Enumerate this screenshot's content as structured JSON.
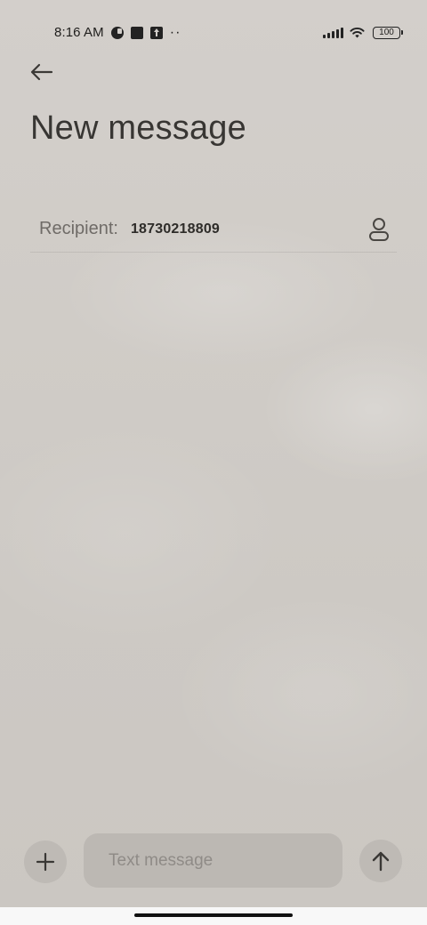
{
  "status_bar": {
    "time": "8:16 AM",
    "left_icons": [
      "circle-status-icon",
      "square-status-icon",
      "upload-status-icon"
    ],
    "more_indicator": "··",
    "battery_level": "100"
  },
  "header": {
    "back_icon": "arrow-left-icon",
    "title": "New message"
  },
  "recipient": {
    "label": "Recipient:",
    "value": "18730218809",
    "contact_icon": "person-icon"
  },
  "composer": {
    "add_icon": "plus-icon",
    "placeholder": "Text message",
    "value": "",
    "send_icon": "arrow-up-icon"
  },
  "colors": {
    "background": "#d0ccc7",
    "controls": "#bebab5",
    "text_primary": "#383633",
    "text_secondary": "#6f6b67"
  }
}
